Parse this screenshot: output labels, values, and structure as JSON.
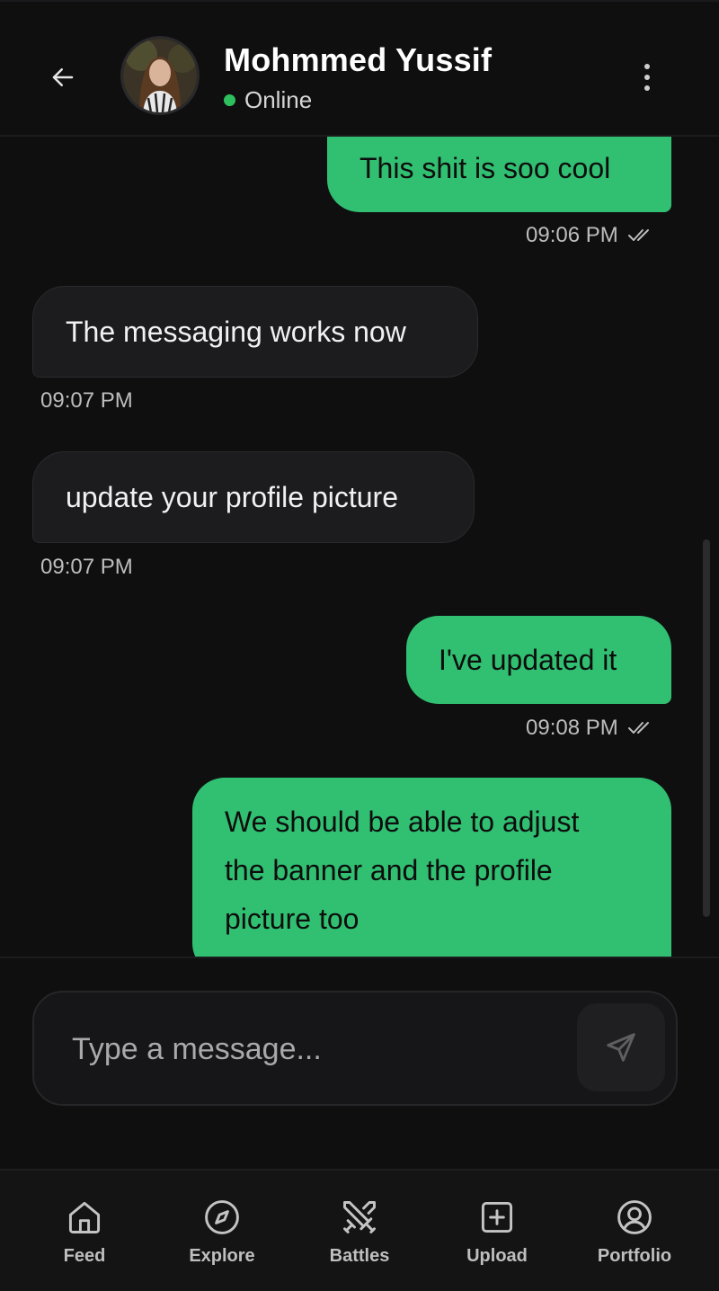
{
  "header": {
    "contact_name": "Mohmmed Yussif",
    "status": "Online",
    "status_color": "#2fc05e"
  },
  "messages": [
    {
      "direction": "sent",
      "text": "This shit is soo cool",
      "time": "09:06 PM",
      "read": true
    },
    {
      "direction": "received",
      "text": "The messaging works now",
      "time": "09:07 PM"
    },
    {
      "direction": "received",
      "text": "update your profile picture",
      "time": "09:07 PM"
    },
    {
      "direction": "sent",
      "text": "I've updated it",
      "time": "09:08 PM",
      "read": true
    },
    {
      "direction": "sent",
      "lines": [
        "We should be able to adjust",
        "the banner and the profile",
        "picture too"
      ]
    }
  ],
  "composer": {
    "placeholder": "Type a message..."
  },
  "nav": {
    "items": [
      {
        "label": "Feed",
        "icon": "home-icon"
      },
      {
        "label": "Explore",
        "icon": "compass-icon"
      },
      {
        "label": "Battles",
        "icon": "crossed-swords-icon"
      },
      {
        "label": "Upload",
        "icon": "plus-square-icon"
      },
      {
        "label": "Portfolio",
        "icon": "user-circle-icon"
      }
    ]
  },
  "colors": {
    "background": "#0f0f10",
    "sent_bubble": "#31bf71",
    "received_bubble": "#1c1c1f",
    "nav_background": "#141415"
  }
}
